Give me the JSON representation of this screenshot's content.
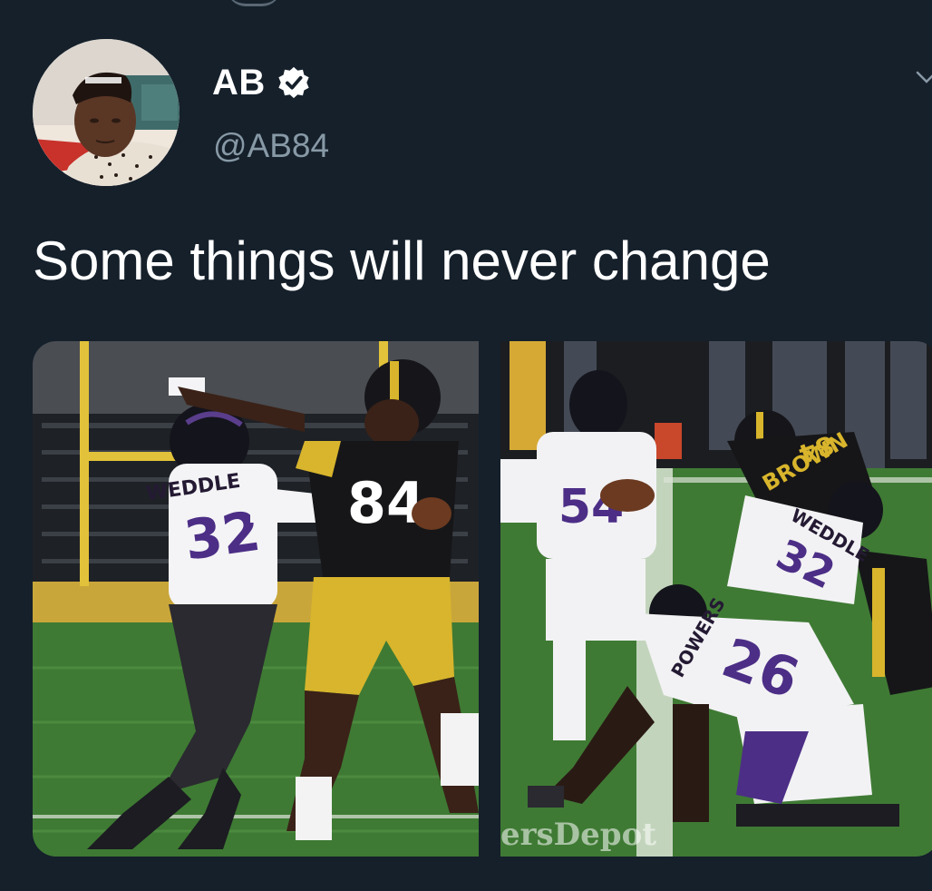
{
  "tweet": {
    "author": {
      "display_name": "AB",
      "handle": "@AB84",
      "verified": true,
      "avatar_icon": "profile-photo"
    },
    "text": "Some things will never change",
    "media": [
      {
        "description_icon": "football-photo-steelers-vs-ravens-stiff-arm",
        "visible_text": [
          "WEDDLE",
          "32",
          "84"
        ]
      },
      {
        "description_icon": "football-photo-tackle-pile",
        "visible_text": [
          "WEDDLE",
          "POWERS",
          "26",
          "32",
          "BROWN",
          "84"
        ],
        "watermark": "ersDepot"
      }
    ]
  },
  "colors": {
    "background": "#15202b",
    "text_primary": "#ffffff",
    "text_secondary": "#8899a6"
  },
  "icons": {
    "verified": "verified-badge-icon",
    "caret": "chevron-down-icon"
  }
}
